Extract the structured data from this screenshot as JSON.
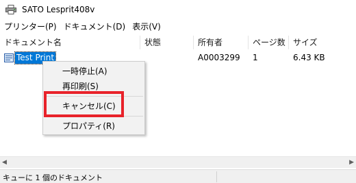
{
  "window": {
    "title": "SATO Lesprit408v",
    "icon": "printer-icon"
  },
  "menu": {
    "items": [
      {
        "label": "プリンター(P)"
      },
      {
        "label": "ドキュメント(D)"
      },
      {
        "label": "表示(V)"
      }
    ]
  },
  "table": {
    "columns": [
      {
        "label": "ドキュメント名"
      },
      {
        "label": "状態"
      },
      {
        "label": "所有者"
      },
      {
        "label": "ページ数"
      },
      {
        "label": "サイズ"
      }
    ],
    "rows": [
      {
        "icon": "document-icon",
        "name": "Test Print",
        "status": "",
        "owner": "A0003299",
        "pages": "1",
        "size": "6.43 KB",
        "selected": true
      }
    ]
  },
  "context_menu": {
    "items": [
      {
        "label": "一時停止(A)"
      },
      {
        "label": "再印刷(S)"
      },
      {
        "label": "キャンセル(C)",
        "highlighted": true
      },
      {
        "label": "プロパティ(R)"
      }
    ],
    "highlight_color": "#e8222a"
  },
  "status_bar": {
    "text": "キューに 1 個のドキュメント"
  },
  "colors": {
    "selection": "#0078d7",
    "menu_bg": "#f2f2f2"
  }
}
